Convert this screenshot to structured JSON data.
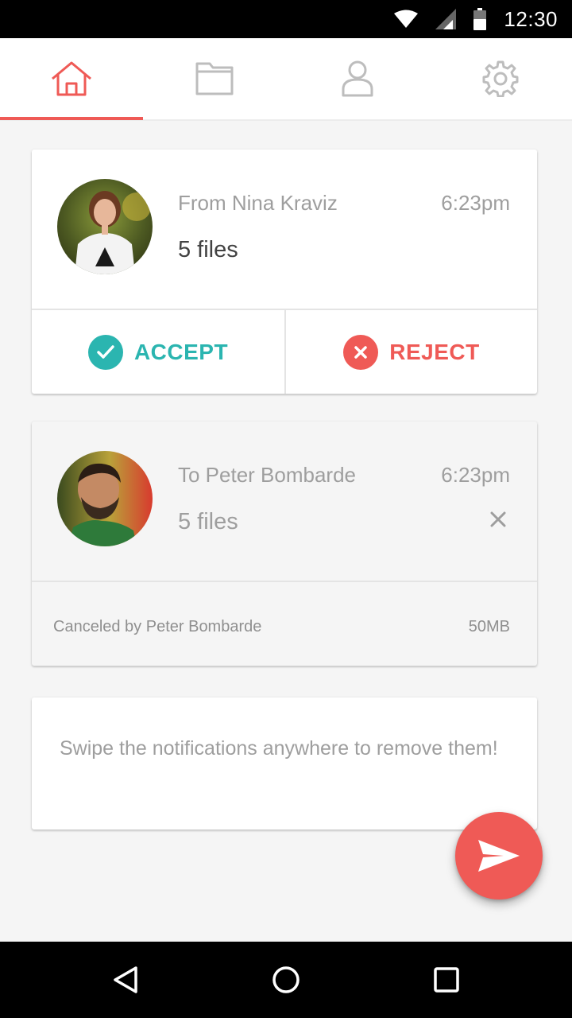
{
  "status_bar": {
    "time": "12:30"
  },
  "tabs": [
    {
      "name": "home",
      "icon": "home-icon",
      "active": true
    },
    {
      "name": "files",
      "icon": "folder-icon",
      "active": false
    },
    {
      "name": "profile",
      "icon": "person-icon",
      "active": false
    },
    {
      "name": "settings",
      "icon": "gear-icon",
      "active": false
    }
  ],
  "colors": {
    "accent": "#ef5a56",
    "accept": "#2bb5b0",
    "text_muted": "#9e9e9e",
    "text_dark": "#424242"
  },
  "incoming": {
    "from": "From Nina Kraviz",
    "time": "6:23pm",
    "files": "5 files",
    "accept_label": "ACCEPT",
    "reject_label": "REJECT"
  },
  "outgoing": {
    "to": "To Peter Bombarde",
    "time": "6:23pm",
    "files": "5 files",
    "status": "Canceled by Peter Bombarde",
    "size": "50MB"
  },
  "hint": {
    "text": "Swipe the notifications anywhere to remove them!"
  },
  "fab": {
    "icon": "send-icon"
  },
  "navbar": {
    "icons": [
      "back-icon",
      "home-circle-icon",
      "recents-icon"
    ]
  }
}
